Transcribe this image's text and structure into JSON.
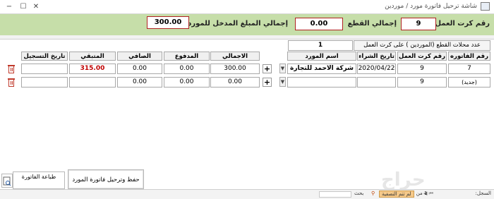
{
  "window": {
    "title": "شاشة ترحيل فاتورة مورد / موردين",
    "min_glyph": "−",
    "max_glyph": "☐",
    "close_glyph": "✕"
  },
  "header": {
    "card_number_label": "رقم كرت العمل",
    "card_number_value": "9",
    "total_parts_label": "إجمالي القطع",
    "total_parts_value": "0.00",
    "total_entered_label": "إجمالي المبلغ المدخل للموردين",
    "total_entered_value": "300.00"
  },
  "counter": {
    "count_value": "1",
    "count_label": "عدد محلات القطع (الموردين ) على كرت العمل"
  },
  "grid": {
    "columns": {
      "invoice_no": "رقم الفاتوره",
      "card_no": "رقم كرت العمل",
      "purchase_date": "تاريخ الشراء",
      "supplier_name": "اسم المورد",
      "total": "الاجمالي",
      "paid": "المدفوع",
      "net": "الصافي",
      "remaining": "المتبقي",
      "reg_date": "تاريخ التسجيل"
    },
    "rows": [
      {
        "invoice_no": "7",
        "card_no": "9",
        "purchase_date": "2020/04/22",
        "supplier_name": "شركة الاحمد للتجارة",
        "total": "300.00",
        "paid": "0.00",
        "net": "0.00",
        "remaining": "315.00",
        "reg_date": ""
      },
      {
        "invoice_no": "(جديد)",
        "card_no": "9",
        "purchase_date": "",
        "supplier_name": "",
        "total": "0.00",
        "paid": "0.00",
        "net": "0.00",
        "remaining": "",
        "reg_date": ""
      }
    ],
    "add_glyph": "+",
    "dropdown_glyph": "▼"
  },
  "buttons": {
    "save_post": "حفظ وترحيل فاتورة المورد",
    "print_invoice": "طباعة الفاتورة"
  },
  "status": {
    "record_label": "السجل:",
    "record_position": "1 من 1",
    "filter_label": "لم تتم التصفية",
    "search_label": "بحث",
    "watermark": "حراج"
  },
  "colors": {
    "header_band": "#c6dea9",
    "box_border": "#b02222",
    "remaining_text": "#c00000",
    "trash": "#c0392b",
    "filter_badge": "#f5c98a"
  }
}
